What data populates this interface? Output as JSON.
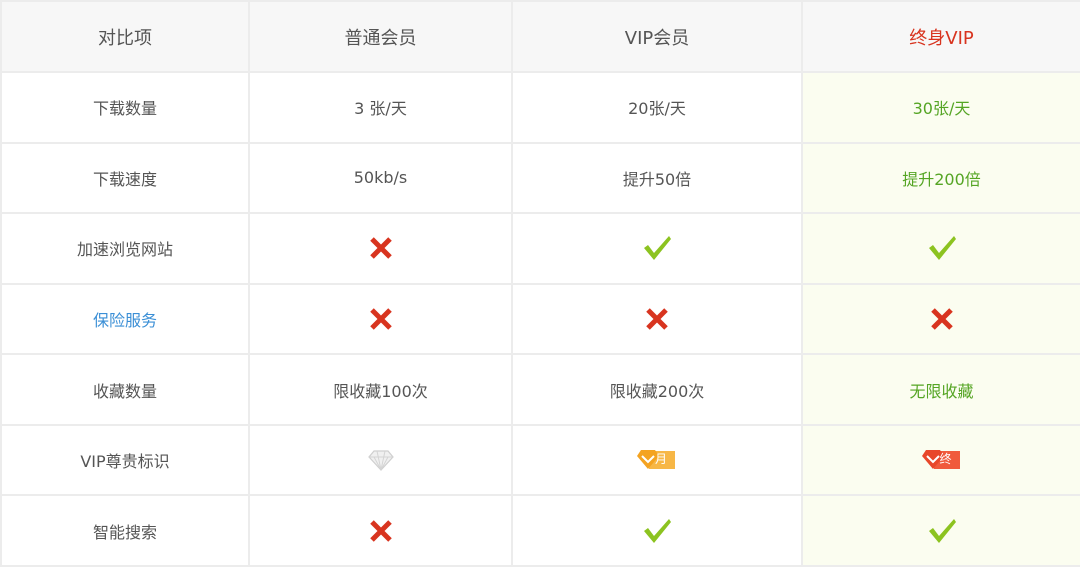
{
  "colors": {
    "cross": "#d8341f",
    "check": "#8cc320",
    "lifetime_text": "#55a524",
    "lifetime_header": "#d8341f",
    "lifetime_bg": "#fbfdf0",
    "link": "#3b8fd6",
    "border": "#ececec",
    "header_bg": "#f7f7f7"
  },
  "header": {
    "feature": "对比项",
    "normal": "普通会员",
    "vip": "VIP会员",
    "lifetime": "终身VIP"
  },
  "rows": [
    {
      "feature": "下载数量",
      "normal": {
        "type": "text",
        "text": "3 张/天"
      },
      "vip": {
        "type": "text",
        "text": "20张/天"
      },
      "lifetime": {
        "type": "text",
        "text": "30张/天"
      }
    },
    {
      "feature": "下载速度",
      "normal": {
        "type": "text",
        "text": "50kb/s"
      },
      "vip": {
        "type": "text",
        "text": "提升50倍"
      },
      "lifetime": {
        "type": "text",
        "text": "提升200倍"
      }
    },
    {
      "feature": "加速浏览网站",
      "normal": {
        "type": "icon",
        "icon": "cross-icon"
      },
      "vip": {
        "type": "icon",
        "icon": "check-icon"
      },
      "lifetime": {
        "type": "icon",
        "icon": "check-icon"
      }
    },
    {
      "feature": "保险服务",
      "feature_is_link": true,
      "normal": {
        "type": "icon",
        "icon": "cross-icon"
      },
      "vip": {
        "type": "icon",
        "icon": "cross-icon"
      },
      "lifetime": {
        "type": "icon",
        "icon": "cross-icon"
      }
    },
    {
      "feature": "收藏数量",
      "normal": {
        "type": "text",
        "text": "限收藏100次"
      },
      "vip": {
        "type": "text",
        "text": "限收藏200次"
      },
      "lifetime": {
        "type": "text",
        "text": "无限收藏"
      }
    },
    {
      "feature": "VIP尊贵标识",
      "normal": {
        "type": "icon",
        "icon": "grey-diamond-icon"
      },
      "vip": {
        "type": "badge",
        "icon": "vip-month-badge-icon",
        "text": "月"
      },
      "lifetime": {
        "type": "badge",
        "icon": "vip-lifetime-badge-icon",
        "text": "终"
      }
    },
    {
      "feature": "智能搜索",
      "normal": {
        "type": "icon",
        "icon": "cross-icon"
      },
      "vip": {
        "type": "icon",
        "icon": "check-icon"
      },
      "lifetime": {
        "type": "icon",
        "icon": "check-icon"
      }
    }
  ]
}
